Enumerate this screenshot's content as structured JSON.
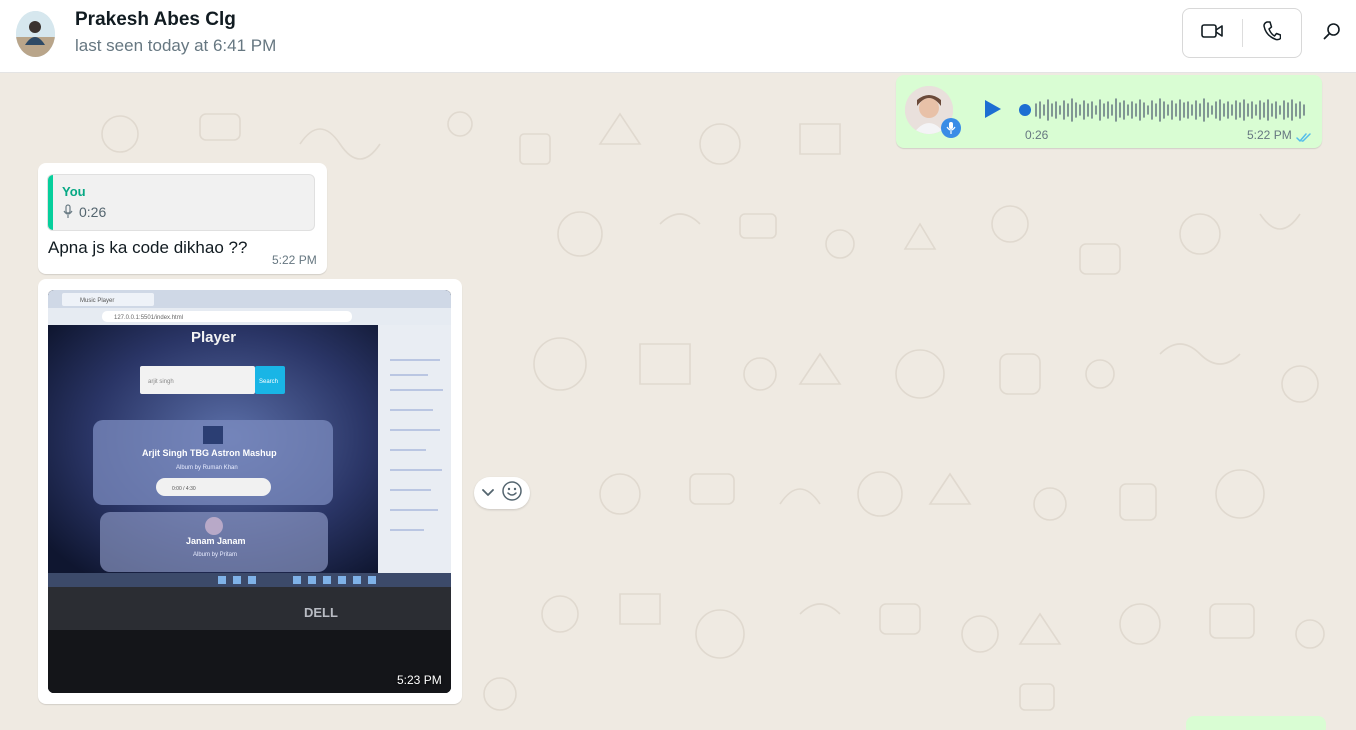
{
  "header": {
    "contact_name": "Prakesh Abes Clg",
    "contact_status": "last seen today at 6:41 PM",
    "icons": [
      "video-call-icon",
      "voice-call-icon",
      "search-icon"
    ]
  },
  "messages": {
    "voice": {
      "duration": "0:26",
      "time": "5:22 PM",
      "status": "read"
    },
    "reply": {
      "quoted_author": "You",
      "quoted_duration": "0:26",
      "text": "Apna js ka code dikhao ??",
      "time": "5:22 PM"
    },
    "image": {
      "time": "5:23 PM",
      "photo_text": {
        "tab_title": "Music Player",
        "url": "127.0.0.1:5501/index.html",
        "heading": "Player",
        "search_value": "arjit singh",
        "search_button": "Search",
        "song1_title": "Arjit Singh TBG Astron Mashup",
        "song1_album": "Album by Ruman Khan",
        "song1_time": "0:00 / 4:30",
        "song2_title": "Janam Janam",
        "song2_album": "Album by Pritam",
        "brand": "DELL"
      }
    }
  },
  "colors": {
    "chat_bg": "#efeae2",
    "outgoing_bubble": "#d9fdd3",
    "incoming_bubble": "#ffffff",
    "quote_accent": "#06cf9c",
    "play_icon": "#1d6ed2",
    "read_tick": "#53bdeb"
  }
}
